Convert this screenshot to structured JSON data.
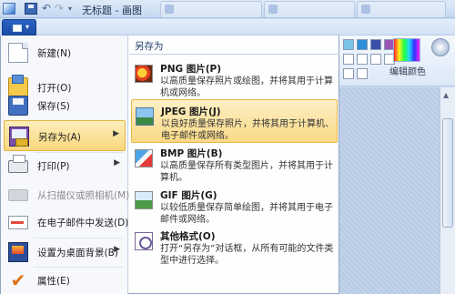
{
  "window": {
    "title": "无标题 - 画图",
    "background_tabs": [
      "",
      "",
      ""
    ]
  },
  "ribbon": {
    "edit_colors_label": "编辑颜色",
    "palette": [
      "#ffffff",
      "#c0c0c0",
      "#808080",
      "#4080c0",
      "#a0c0e0",
      "#ffffff",
      "#ffffff",
      "#ffffff",
      "#ffffff",
      "#ffffff",
      "#ffffff",
      "#ffffff",
      "#ffffff",
      "#ffffff",
      "#ffffff"
    ]
  },
  "menu_left": {
    "items": [
      {
        "label": "新建(N)",
        "icon": "new-file-icon",
        "submenu": false,
        "enabled": true
      },
      {
        "label": "打开(O)",
        "icon": "open-folder-icon",
        "submenu": false,
        "enabled": true
      },
      {
        "label": "保存(S)",
        "icon": "save-disk-icon",
        "submenu": false,
        "enabled": true
      },
      {
        "label": "另存为(A)",
        "icon": "save-as-icon",
        "submenu": true,
        "enabled": true,
        "active": true
      },
      {
        "label": "打印(P)",
        "icon": "printer-icon",
        "submenu": true,
        "enabled": true
      },
      {
        "label": "从扫描仪或照相机(M)",
        "icon": "scanner-icon",
        "submenu": false,
        "enabled": false
      },
      {
        "label": "在电子邮件中发送(D)",
        "icon": "email-icon",
        "submenu": false,
        "enabled": true
      },
      {
        "label": "设置为桌面背景(B)",
        "icon": "desktop-background-icon",
        "submenu": true,
        "enabled": true
      },
      {
        "label": "属性(E)",
        "icon": "properties-checkmark-icon",
        "submenu": false,
        "enabled": true
      }
    ]
  },
  "menu_right": {
    "title": "另存为",
    "formats": [
      {
        "title": "PNG 图片(P)",
        "desc": "以高质量保存照片或绘图，并将其用于计算机或网络。",
        "icon": "png-image-icon"
      },
      {
        "title": "JPEG 图片(J)",
        "desc": "以良好质量保存照片，并将其用于计算机、电子邮件或网络。",
        "icon": "jpeg-image-icon",
        "active": true
      },
      {
        "title": "BMP 图片(B)",
        "desc": "以高质量保存所有类型图片，并将其用于计算机。",
        "icon": "bmp-image-icon"
      },
      {
        "title": "GIF 图片(G)",
        "desc": "以较低质量保存简单绘图，并将其用于电子邮件或网络。",
        "icon": "gif-image-icon"
      },
      {
        "title": "其他格式(O)",
        "desc": "打开“另存为”对话框，从所有可能的文件类型中进行选择。",
        "icon": "other-formats-icon"
      }
    ]
  }
}
